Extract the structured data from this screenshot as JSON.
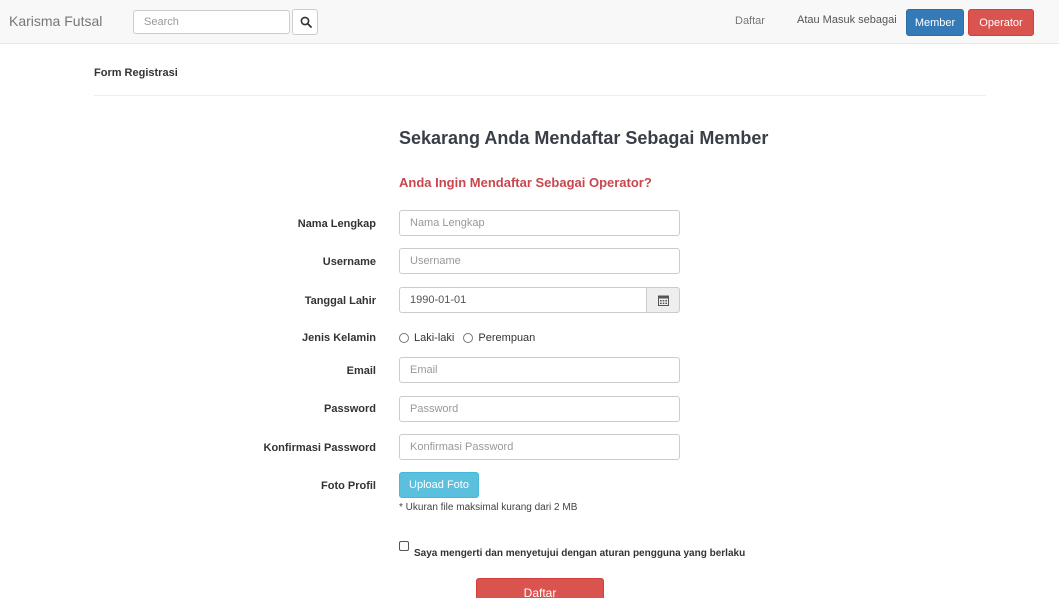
{
  "navbar": {
    "brand": "Karisma Futsal",
    "search_placeholder": "Search",
    "search_icon": "search-icon",
    "link_daftar": "Daftar",
    "login_text": "Atau Masuk sebagai",
    "btn_member": "Member",
    "btn_operator": "Operator"
  },
  "page": {
    "header": "Form Registrasi",
    "title": "Sekarang Anda Mendaftar Sebagai Member",
    "switch_link": "Anda Ingin Mendaftar Sebagai Operator?"
  },
  "form": {
    "nama_label": "Nama Lengkap",
    "nama_placeholder": "Nama Lengkap",
    "username_label": "Username",
    "username_placeholder": "Username",
    "tanggal_label": "Tanggal Lahir",
    "tanggal_value": "1990-01-01",
    "calendar_icon": "calendar-icon",
    "gender_label": "Jenis Kelamin",
    "gender_options": [
      "Laki-laki",
      "Perempuan"
    ],
    "email_label": "Email",
    "email_placeholder": "Email",
    "password_label": "Password",
    "password_placeholder": "Password",
    "konfirmasi_label": "Konfirmasi Password",
    "konfirmasi_placeholder": "Konfirmasi Password",
    "foto_label": "Foto Profil",
    "upload_button": "Upload Foto",
    "upload_note": "* Ukuran file maksimal kurang dari 2 MB",
    "agree_text": "Saya mengerti dan menyetujui dengan aturan pengguna yang berlaku",
    "submit_button": "Daftar"
  },
  "colors": {
    "primary": "#337ab7",
    "danger": "#d9534f",
    "info": "#5bc0de",
    "link_danger": "#c9464e"
  }
}
